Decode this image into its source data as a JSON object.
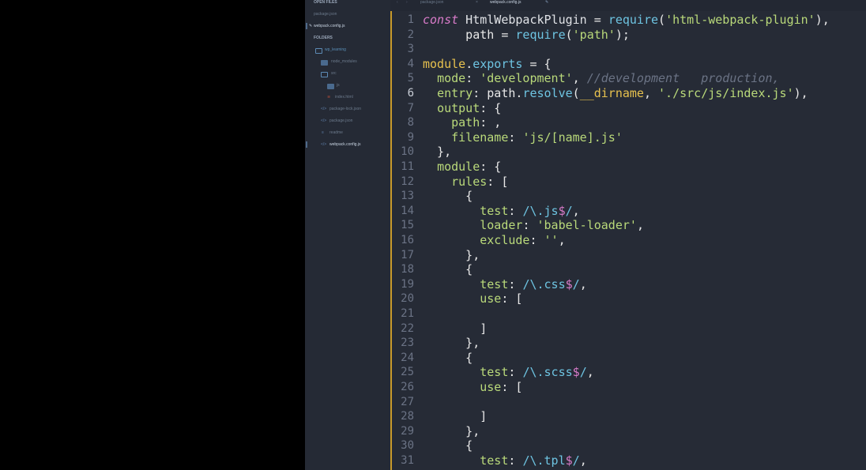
{
  "window": {
    "tabs": [
      {
        "label": "package.json",
        "active": false
      },
      {
        "label": "webpack.config.js",
        "active": true
      }
    ],
    "accent_color": "#c89a2a"
  },
  "sidebar": {
    "open_files_header": "OPEN FILES",
    "open_files": [
      "package.json",
      "webpack.config.js"
    ],
    "folders_header": "FOLDERS",
    "tree": [
      {
        "label": "wp_learning",
        "type": "folder",
        "depth": 0
      },
      {
        "label": "node_modules",
        "type": "folder",
        "depth": 1
      },
      {
        "label": "src",
        "type": "folder",
        "depth": 1
      },
      {
        "label": "js",
        "type": "folder",
        "depth": 2
      },
      {
        "label": "index.html",
        "type": "file",
        "depth": 2
      },
      {
        "label": "package-lock.json",
        "type": "file",
        "depth": 1
      },
      {
        "label": "package.json",
        "type": "file",
        "depth": 1
      },
      {
        "label": "readme",
        "type": "file",
        "depth": 1
      },
      {
        "label": "webpack.config.js",
        "type": "file",
        "depth": 1
      }
    ]
  },
  "editor": {
    "current_line": 6,
    "lines": [
      {
        "n": 1,
        "tokens": [
          [
            "kw",
            "const"
          ],
          [
            "cls",
            " HtmlWebpackPlugin "
          ],
          [
            "",
            "= "
          ],
          [
            "fn",
            "require"
          ],
          [
            "",
            "("
          ],
          [
            "str",
            "'html-webpack-plugin'"
          ],
          [
            "",
            "),"
          ]
        ]
      },
      {
        "n": 2,
        "tokens": [
          [
            "",
            "      path = "
          ],
          [
            "fn",
            "require"
          ],
          [
            "",
            "("
          ],
          [
            "str",
            "'path'"
          ],
          [
            "",
            ");"
          ]
        ]
      },
      {
        "n": 3,
        "tokens": []
      },
      {
        "n": 4,
        "tokens": [
          [
            "obj",
            "module"
          ],
          [
            "",
            "."
          ],
          [
            "prop",
            "exports"
          ],
          [
            "",
            " = {"
          ]
        ]
      },
      {
        "n": 5,
        "tokens": [
          [
            "",
            "  "
          ],
          [
            "key",
            "mode"
          ],
          [
            "",
            ": "
          ],
          [
            "str",
            "'development'"
          ],
          [
            "",
            ", "
          ],
          [
            "cm",
            "//development   production,"
          ]
        ]
      },
      {
        "n": 6,
        "tokens": [
          [
            "",
            "  "
          ],
          [
            "key",
            "entry"
          ],
          [
            "",
            ": path."
          ],
          [
            "fn",
            "resolve"
          ],
          [
            "",
            "("
          ],
          [
            "obj",
            "__dirname"
          ],
          [
            "",
            ", "
          ],
          [
            "str",
            "'./src/js/index.js'"
          ],
          [
            "",
            "),"
          ]
        ]
      },
      {
        "n": 7,
        "tokens": [
          [
            "",
            "  "
          ],
          [
            "key",
            "output"
          ],
          [
            "",
            ": {"
          ]
        ]
      },
      {
        "n": 8,
        "tokens": [
          [
            "",
            "    "
          ],
          [
            "key",
            "path"
          ],
          [
            "",
            ": ,"
          ]
        ]
      },
      {
        "n": 9,
        "tokens": [
          [
            "",
            "    "
          ],
          [
            "key",
            "filename"
          ],
          [
            "",
            ": "
          ],
          [
            "str",
            "'js/[name].js'"
          ]
        ]
      },
      {
        "n": 10,
        "tokens": [
          [
            "",
            "  },"
          ]
        ]
      },
      {
        "n": 11,
        "tokens": [
          [
            "",
            "  "
          ],
          [
            "key",
            "module"
          ],
          [
            "",
            ": {"
          ]
        ]
      },
      {
        "n": 12,
        "tokens": [
          [
            "",
            "    "
          ],
          [
            "key",
            "rules"
          ],
          [
            "",
            ": ["
          ]
        ]
      },
      {
        "n": 13,
        "tokens": [
          [
            "",
            "      {"
          ]
        ]
      },
      {
        "n": 14,
        "tokens": [
          [
            "",
            "        "
          ],
          [
            "key",
            "test"
          ],
          [
            "",
            ": "
          ],
          [
            "rx",
            "/\\.js"
          ],
          [
            "rxd",
            "$"
          ],
          [
            "rx",
            "/"
          ],
          [
            "",
            ","
          ]
        ]
      },
      {
        "n": 15,
        "tokens": [
          [
            "",
            "        "
          ],
          [
            "key",
            "loader"
          ],
          [
            "",
            ": "
          ],
          [
            "str",
            "'babel-loader'"
          ],
          [
            "",
            ","
          ]
        ]
      },
      {
        "n": 16,
        "tokens": [
          [
            "",
            "        "
          ],
          [
            "key",
            "exclude"
          ],
          [
            "",
            ": "
          ],
          [
            "str",
            "''"
          ],
          [
            "",
            ","
          ]
        ]
      },
      {
        "n": 17,
        "tokens": [
          [
            "",
            "      },"
          ]
        ]
      },
      {
        "n": 18,
        "tokens": [
          [
            "",
            "      {"
          ]
        ]
      },
      {
        "n": 19,
        "tokens": [
          [
            "",
            "        "
          ],
          [
            "key",
            "test"
          ],
          [
            "",
            ": "
          ],
          [
            "rx",
            "/\\.css"
          ],
          [
            "rxd",
            "$"
          ],
          [
            "rx",
            "/"
          ],
          [
            "",
            ","
          ]
        ]
      },
      {
        "n": 20,
        "tokens": [
          [
            "",
            "        "
          ],
          [
            "key",
            "use"
          ],
          [
            "",
            ": ["
          ]
        ]
      },
      {
        "n": 21,
        "tokens": []
      },
      {
        "n": 22,
        "tokens": [
          [
            "",
            "        ]"
          ]
        ]
      },
      {
        "n": 23,
        "tokens": [
          [
            "",
            "      },"
          ]
        ]
      },
      {
        "n": 24,
        "tokens": [
          [
            "",
            "      {"
          ]
        ]
      },
      {
        "n": 25,
        "tokens": [
          [
            "",
            "        "
          ],
          [
            "key",
            "test"
          ],
          [
            "",
            ": "
          ],
          [
            "rx",
            "/\\.scss"
          ],
          [
            "rxd",
            "$"
          ],
          [
            "rx",
            "/"
          ],
          [
            "",
            ","
          ]
        ]
      },
      {
        "n": 26,
        "tokens": [
          [
            "",
            "        "
          ],
          [
            "key",
            "use"
          ],
          [
            "",
            ": ["
          ]
        ]
      },
      {
        "n": 27,
        "tokens": []
      },
      {
        "n": 28,
        "tokens": [
          [
            "",
            "        ]"
          ]
        ]
      },
      {
        "n": 29,
        "tokens": [
          [
            "",
            "      },"
          ]
        ]
      },
      {
        "n": 30,
        "tokens": [
          [
            "",
            "      {"
          ]
        ]
      },
      {
        "n": 31,
        "tokens": [
          [
            "",
            "        "
          ],
          [
            "key",
            "test"
          ],
          [
            "",
            ": "
          ],
          [
            "rx",
            "/\\.tpl"
          ],
          [
            "rxd",
            "$"
          ],
          [
            "rx",
            "/"
          ],
          [
            "",
            ","
          ]
        ]
      }
    ]
  }
}
